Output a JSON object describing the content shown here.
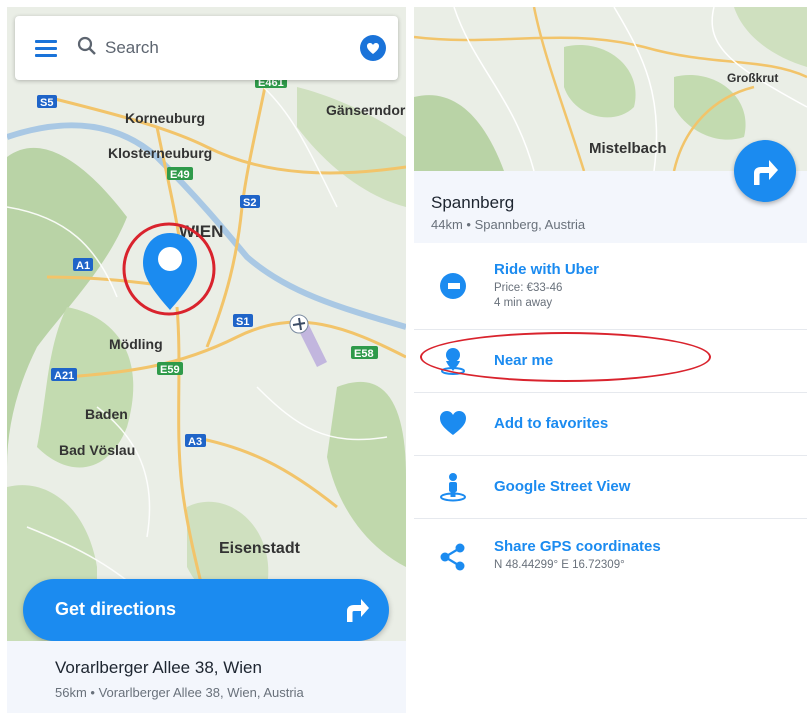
{
  "search": {
    "placeholder": "Search"
  },
  "map_labels": {
    "korneuburg": "Korneuburg",
    "gaenserndorf": "Gänserndor",
    "klosterneuburg": "Klosterneuburg",
    "wien": "WIEN",
    "moedling": "Mödling",
    "baden": "Baden",
    "bad_voeslau": "Bad Vöslau",
    "eisenstadt": "Eisenstadt",
    "grosskrut": "Großkrut",
    "mistelbach": "Mistelbach"
  },
  "road_shields": {
    "e461": "E461",
    "s5": "S5",
    "e49": "E49",
    "s2": "S2",
    "a1": "A1",
    "s1": "S1",
    "e58": "E58",
    "a21": "A21",
    "e59": "E59",
    "a3": "A3"
  },
  "left": {
    "directions_label": "Get directions",
    "address_title": "Vorarlberger Allee 38, Wien",
    "address_sub": "56km • Vorarlberger Allee 38, Wien, Austria"
  },
  "right": {
    "place_title": "Spannberg",
    "place_sub": "44km • Spannberg, Austria",
    "actions": [
      {
        "label": "Ride with Uber",
        "details": [
          "Price: €33-46",
          "4 min away"
        ]
      },
      {
        "label": "Near me"
      },
      {
        "label": "Add to favorites"
      },
      {
        "label": "Google Street View"
      },
      {
        "label": "Share GPS coordinates",
        "details": [
          "N 48.44299° E 16.72309°"
        ]
      }
    ]
  },
  "colors": {
    "accent": "#1b8bf0",
    "highlight": "#d9232d"
  }
}
